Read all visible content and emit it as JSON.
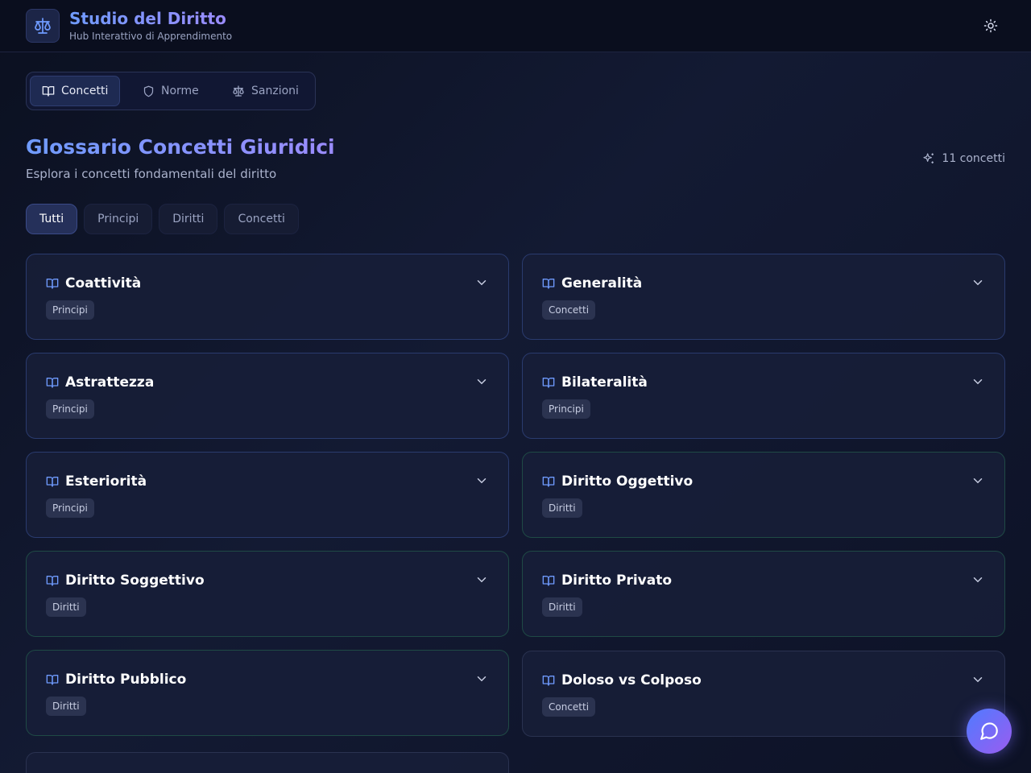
{
  "header": {
    "title": "Studio del Diritto",
    "subtitle": "Hub Interattivo di Apprendimento",
    "logo_icon": "scales-icon",
    "theme_icon": "sun-icon"
  },
  "nav": {
    "tabs": [
      {
        "label": "Concetti",
        "icon": "book-open-icon",
        "active": true
      },
      {
        "label": "Norme",
        "icon": "shield-icon",
        "active": false
      },
      {
        "label": "Sanzioni",
        "icon": "scales-icon",
        "active": false
      }
    ]
  },
  "page": {
    "title": "Glossario Concetti Giuridici",
    "subtitle": "Esplora i concetti fondamentali del diritto",
    "count_label": "11 concetti"
  },
  "filters": [
    "Tutti",
    "Principi",
    "Diritti",
    "Concetti"
  ],
  "cards": [
    {
      "title": "Coattività",
      "category": "Principi"
    },
    {
      "title": "Generalità",
      "category": "Concetti"
    },
    {
      "title": "Astrattezza",
      "category": "Principi"
    },
    {
      "title": "Bilateralità",
      "category": "Principi"
    },
    {
      "title": "Esteriorità",
      "category": "Principi"
    },
    {
      "title": "Diritto Oggettivo",
      "category": "Diritti"
    },
    {
      "title": "Diritto Soggettivo",
      "category": "Diritti"
    },
    {
      "title": "Diritto Privato",
      "category": "Diritti"
    },
    {
      "title": "Diritto Pubblico",
      "category": "Diritti"
    },
    {
      "title": "Doloso vs Colposo",
      "category": "Concetti"
    }
  ],
  "colors": {
    "accent_blue": "#6f9bff",
    "accent_purple": "#9b8cff",
    "border_principi": "#2a3b6e",
    "border_diritti": "#1f4a45"
  },
  "chat_icon": "message-circle-icon"
}
